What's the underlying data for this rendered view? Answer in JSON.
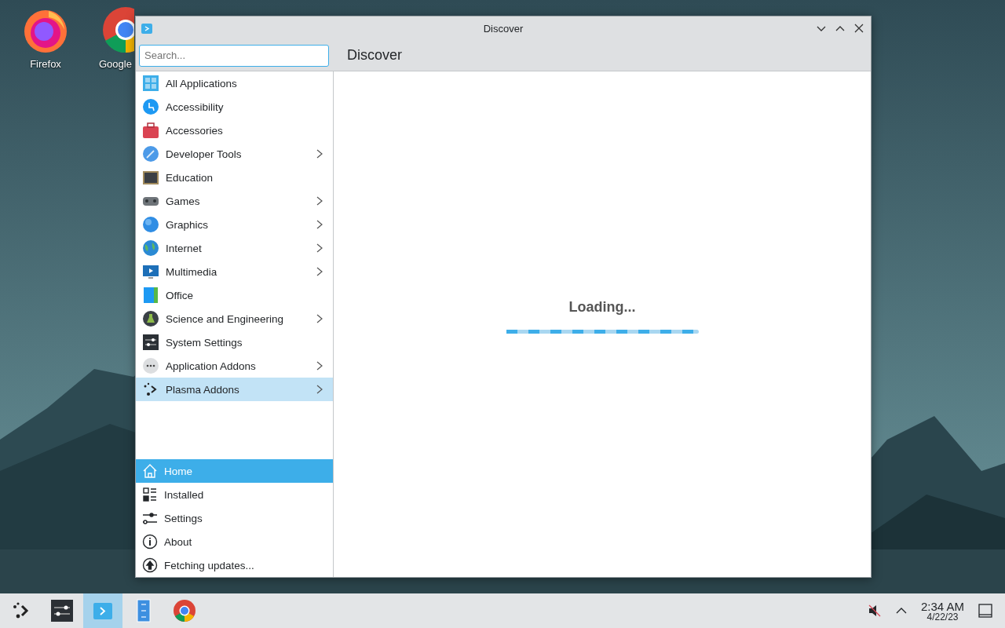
{
  "desktop_icons": [
    {
      "label": "Firefox"
    },
    {
      "label": "Google"
    }
  ],
  "window": {
    "title": "Discover",
    "search": {
      "placeholder": "Search..."
    },
    "page_title": "Discover",
    "categories": [
      {
        "label": "All Applications",
        "expandable": false,
        "selected": false
      },
      {
        "label": "Accessibility",
        "expandable": false,
        "selected": false
      },
      {
        "label": "Accessories",
        "expandable": false,
        "selected": false
      },
      {
        "label": "Developer Tools",
        "expandable": true,
        "selected": false
      },
      {
        "label": "Education",
        "expandable": false,
        "selected": false
      },
      {
        "label": "Games",
        "expandable": true,
        "selected": false
      },
      {
        "label": "Graphics",
        "expandable": true,
        "selected": false
      },
      {
        "label": "Internet",
        "expandable": true,
        "selected": false
      },
      {
        "label": "Multimedia",
        "expandable": true,
        "selected": false
      },
      {
        "label": "Office",
        "expandable": false,
        "selected": false
      },
      {
        "label": "Science and Engineering",
        "expandable": true,
        "selected": false
      },
      {
        "label": "System Settings",
        "expandable": false,
        "selected": false
      },
      {
        "label": "Application Addons",
        "expandable": true,
        "selected": false
      },
      {
        "label": "Plasma Addons",
        "expandable": true,
        "selected": true
      }
    ],
    "nav": [
      {
        "label": "Home",
        "selected": true
      },
      {
        "label": "Installed",
        "selected": false
      },
      {
        "label": "Settings",
        "selected": false
      },
      {
        "label": "About",
        "selected": false
      },
      {
        "label": "Fetching updates...",
        "selected": false
      }
    ],
    "status": "Loading..."
  },
  "taskbar": {
    "items": [
      {
        "active": false
      },
      {
        "active": false
      },
      {
        "active": true
      },
      {
        "active": false
      },
      {
        "active": false
      }
    ],
    "time": "2:34 AM",
    "date": "4/22/23"
  }
}
